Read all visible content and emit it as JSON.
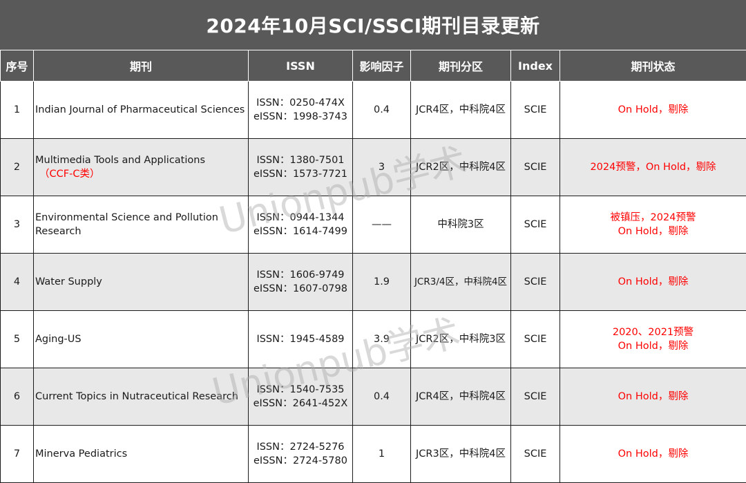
{
  "title": "2024年10月SCI/SSCI期刊目录更新",
  "headers": {
    "no": "序号",
    "journal": "期刊",
    "issn": "ISSN",
    "impact": "影响因子",
    "zone": "期刊分区",
    "index": "Index",
    "status": "期刊状态"
  },
  "rows": [
    {
      "no": "1",
      "journal": "Indian Journal of Pharmaceutical Sciences",
      "tag": "",
      "issn": "ISSN：0250-474X",
      "eissn": "eISSN：1998-3743",
      "impact": "0.4",
      "zone": "JCR4区，中科院4区",
      "index": "SCIE",
      "status1": "On Hold，剔除",
      "status2": ""
    },
    {
      "no": "2",
      "journal": "Multimedia Tools and Applications",
      "tag": "（CCF-C类）",
      "issn": "ISSN：1380-7501",
      "eissn": "eISSN：1573-7721",
      "impact": "3",
      "zone": "JCR2区，中科院4区",
      "index": "SCIE",
      "status1": "2024预警，On Hold，剔除",
      "status2": ""
    },
    {
      "no": "3",
      "journal": "Environmental Science and Pollution Research",
      "tag": "",
      "issn": "ISSN：0944-1344",
      "eissn": "eISSN：1614-7499",
      "impact": "——",
      "zone": "中科院3区",
      "index": "SCIE",
      "status1": "被镇压，2024预警",
      "status2": "On Hold，剔除"
    },
    {
      "no": "4",
      "journal": "Water Supply",
      "tag": "",
      "issn": "ISSN：1606-9749",
      "eissn": "eISSN：1607-0798",
      "impact": "1.9",
      "zone": "JCR3/4区，中科院4区",
      "index": "SCIE",
      "status1": "On Hold，剔除",
      "status2": ""
    },
    {
      "no": "5",
      "journal": "Aging-US",
      "tag": "",
      "issn": "ISSN：1945-4589",
      "eissn": "",
      "impact": "3.9",
      "zone": "JCR2区，中科院3区",
      "index": "SCIE",
      "status1": "2020、2021预警",
      "status2": "On Hold，剔除"
    },
    {
      "no": "6",
      "journal": "Current Topics in Nutraceutical Research",
      "tag": "",
      "issn": "ISSN：1540-7535",
      "eissn": "eISSN：2641-452X",
      "impact": "0.4",
      "zone": "JCR4区，中科院4区",
      "index": "SCIE",
      "status1": "On Hold，剔除",
      "status2": ""
    },
    {
      "no": "7",
      "journal": "Minerva Pediatrics",
      "tag": "",
      "issn": "ISSN：2724-5276",
      "eissn": "eISSN：2724-5780",
      "impact": "1",
      "zone": "JCR3区，中科院4区",
      "index": "SCIE",
      "status1": "On Hold，剔除",
      "status2": ""
    }
  ],
  "watermark": "Unionpub学术",
  "colors": {
    "header_bg": "#595959",
    "alt_row": "#e8e8e8",
    "status_red": "#ff0000"
  }
}
